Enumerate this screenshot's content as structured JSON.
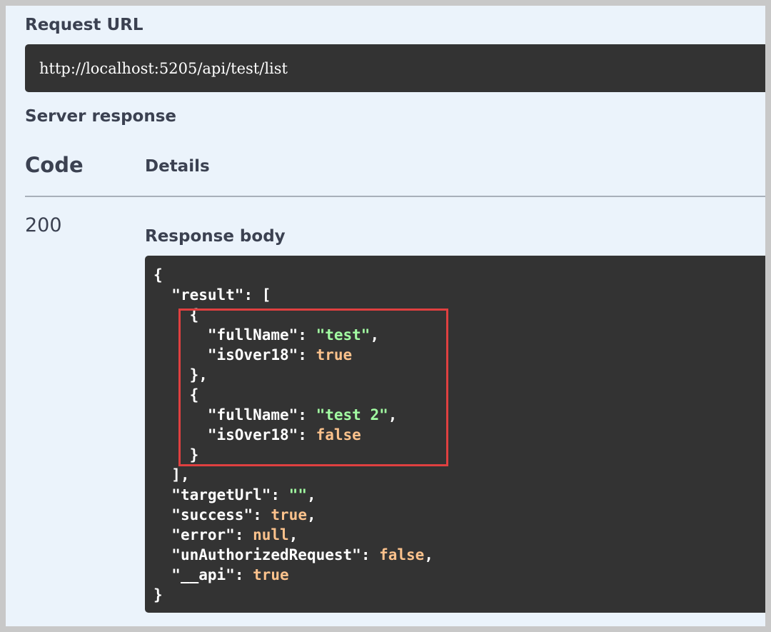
{
  "request_url_heading": "Request URL",
  "request_url": "http://localhost:5205/api/test/list",
  "server_response_heading": "Server response",
  "table_headers": {
    "code": "Code",
    "details": "Details"
  },
  "response": {
    "status_code": "200",
    "body_heading": "Response body",
    "body_lines": [
      [
        {
          "t": "punc",
          "v": "{"
        }
      ],
      [
        {
          "t": "punc",
          "v": "  "
        },
        {
          "t": "key",
          "v": "\"result\""
        },
        {
          "t": "punc",
          "v": ": ["
        }
      ],
      [
        {
          "t": "punc",
          "v": "    {"
        }
      ],
      [
        {
          "t": "punc",
          "v": "      "
        },
        {
          "t": "key",
          "v": "\"fullName\""
        },
        {
          "t": "punc",
          "v": ": "
        },
        {
          "t": "str",
          "v": "\"test\""
        },
        {
          "t": "punc",
          "v": ","
        }
      ],
      [
        {
          "t": "punc",
          "v": "      "
        },
        {
          "t": "key",
          "v": "\"isOver18\""
        },
        {
          "t": "punc",
          "v": ": "
        },
        {
          "t": "lit",
          "v": "true"
        }
      ],
      [
        {
          "t": "punc",
          "v": "    },"
        }
      ],
      [
        {
          "t": "punc",
          "v": "    {"
        }
      ],
      [
        {
          "t": "punc",
          "v": "      "
        },
        {
          "t": "key",
          "v": "\"fullName\""
        },
        {
          "t": "punc",
          "v": ": "
        },
        {
          "t": "str",
          "v": "\"test 2\""
        },
        {
          "t": "punc",
          "v": ","
        }
      ],
      [
        {
          "t": "punc",
          "v": "      "
        },
        {
          "t": "key",
          "v": "\"isOver18\""
        },
        {
          "t": "punc",
          "v": ": "
        },
        {
          "t": "lit",
          "v": "false"
        }
      ],
      [
        {
          "t": "punc",
          "v": "    }"
        }
      ],
      [
        {
          "t": "punc",
          "v": "  ],"
        }
      ],
      [
        {
          "t": "punc",
          "v": "  "
        },
        {
          "t": "key",
          "v": "\"targetUrl\""
        },
        {
          "t": "punc",
          "v": ": "
        },
        {
          "t": "str",
          "v": "\"\""
        },
        {
          "t": "punc",
          "v": ","
        }
      ],
      [
        {
          "t": "punc",
          "v": "  "
        },
        {
          "t": "key",
          "v": "\"success\""
        },
        {
          "t": "punc",
          "v": ": "
        },
        {
          "t": "lit",
          "v": "true"
        },
        {
          "t": "punc",
          "v": ","
        }
      ],
      [
        {
          "t": "punc",
          "v": "  "
        },
        {
          "t": "key",
          "v": "\"error\""
        },
        {
          "t": "punc",
          "v": ": "
        },
        {
          "t": "lit",
          "v": "null"
        },
        {
          "t": "punc",
          "v": ","
        }
      ],
      [
        {
          "t": "punc",
          "v": "  "
        },
        {
          "t": "key",
          "v": "\"unAuthorizedRequest\""
        },
        {
          "t": "punc",
          "v": ": "
        },
        {
          "t": "lit",
          "v": "false"
        },
        {
          "t": "punc",
          "v": ","
        }
      ],
      [
        {
          "t": "punc",
          "v": "  "
        },
        {
          "t": "key",
          "v": "\"__api\""
        },
        {
          "t": "punc",
          "v": ": "
        },
        {
          "t": "lit",
          "v": "true"
        }
      ],
      [
        {
          "t": "punc",
          "v": "}"
        }
      ]
    ]
  },
  "colors": {
    "panel_bg": "#ebf3fb",
    "code_bg": "#333333",
    "string": "#a2fca2",
    "literal": "#fcc28c",
    "highlight_border": "#e04040"
  }
}
